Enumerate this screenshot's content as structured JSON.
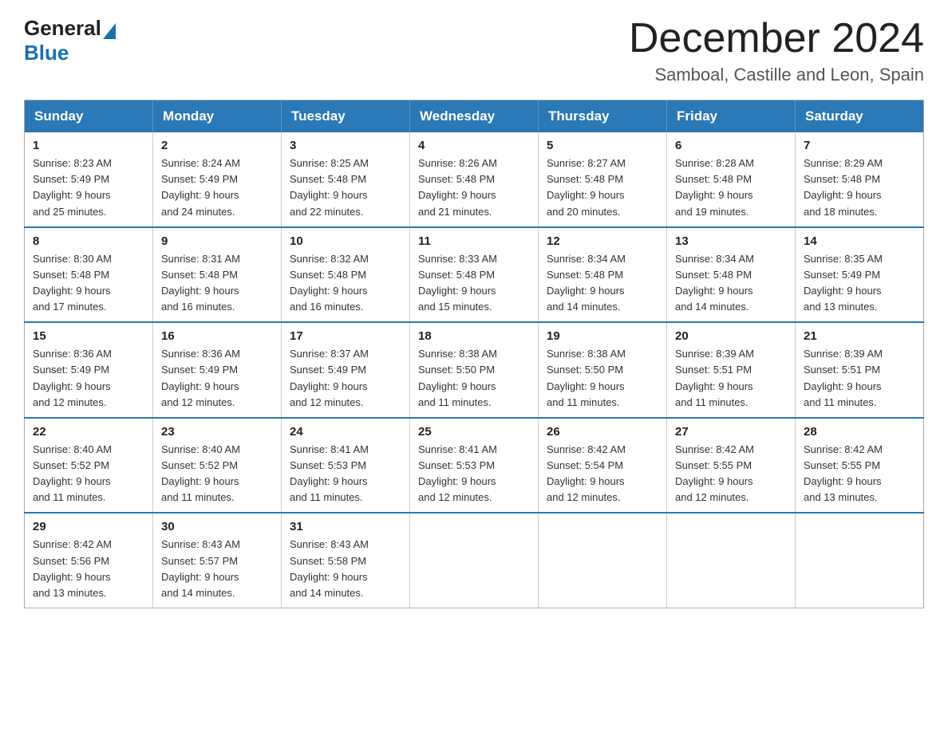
{
  "header": {
    "logo": {
      "text_general": "General",
      "text_blue": "Blue",
      "triangle_aria": "logo-triangle-icon"
    },
    "month_title": "December 2024",
    "location": "Samboal, Castille and Leon, Spain"
  },
  "days_of_week": [
    "Sunday",
    "Monday",
    "Tuesday",
    "Wednesday",
    "Thursday",
    "Friday",
    "Saturday"
  ],
  "weeks": [
    [
      {
        "day": "1",
        "sunrise": "Sunrise: 8:23 AM",
        "sunset": "Sunset: 5:49 PM",
        "daylight": "Daylight: 9 hours",
        "daylight2": "and 25 minutes."
      },
      {
        "day": "2",
        "sunrise": "Sunrise: 8:24 AM",
        "sunset": "Sunset: 5:49 PM",
        "daylight": "Daylight: 9 hours",
        "daylight2": "and 24 minutes."
      },
      {
        "day": "3",
        "sunrise": "Sunrise: 8:25 AM",
        "sunset": "Sunset: 5:48 PM",
        "daylight": "Daylight: 9 hours",
        "daylight2": "and 22 minutes."
      },
      {
        "day": "4",
        "sunrise": "Sunrise: 8:26 AM",
        "sunset": "Sunset: 5:48 PM",
        "daylight": "Daylight: 9 hours",
        "daylight2": "and 21 minutes."
      },
      {
        "day": "5",
        "sunrise": "Sunrise: 8:27 AM",
        "sunset": "Sunset: 5:48 PM",
        "daylight": "Daylight: 9 hours",
        "daylight2": "and 20 minutes."
      },
      {
        "day": "6",
        "sunrise": "Sunrise: 8:28 AM",
        "sunset": "Sunset: 5:48 PM",
        "daylight": "Daylight: 9 hours",
        "daylight2": "and 19 minutes."
      },
      {
        "day": "7",
        "sunrise": "Sunrise: 8:29 AM",
        "sunset": "Sunset: 5:48 PM",
        "daylight": "Daylight: 9 hours",
        "daylight2": "and 18 minutes."
      }
    ],
    [
      {
        "day": "8",
        "sunrise": "Sunrise: 8:30 AM",
        "sunset": "Sunset: 5:48 PM",
        "daylight": "Daylight: 9 hours",
        "daylight2": "and 17 minutes."
      },
      {
        "day": "9",
        "sunrise": "Sunrise: 8:31 AM",
        "sunset": "Sunset: 5:48 PM",
        "daylight": "Daylight: 9 hours",
        "daylight2": "and 16 minutes."
      },
      {
        "day": "10",
        "sunrise": "Sunrise: 8:32 AM",
        "sunset": "Sunset: 5:48 PM",
        "daylight": "Daylight: 9 hours",
        "daylight2": "and 16 minutes."
      },
      {
        "day": "11",
        "sunrise": "Sunrise: 8:33 AM",
        "sunset": "Sunset: 5:48 PM",
        "daylight": "Daylight: 9 hours",
        "daylight2": "and 15 minutes."
      },
      {
        "day": "12",
        "sunrise": "Sunrise: 8:34 AM",
        "sunset": "Sunset: 5:48 PM",
        "daylight": "Daylight: 9 hours",
        "daylight2": "and 14 minutes."
      },
      {
        "day": "13",
        "sunrise": "Sunrise: 8:34 AM",
        "sunset": "Sunset: 5:48 PM",
        "daylight": "Daylight: 9 hours",
        "daylight2": "and 14 minutes."
      },
      {
        "day": "14",
        "sunrise": "Sunrise: 8:35 AM",
        "sunset": "Sunset: 5:49 PM",
        "daylight": "Daylight: 9 hours",
        "daylight2": "and 13 minutes."
      }
    ],
    [
      {
        "day": "15",
        "sunrise": "Sunrise: 8:36 AM",
        "sunset": "Sunset: 5:49 PM",
        "daylight": "Daylight: 9 hours",
        "daylight2": "and 12 minutes."
      },
      {
        "day": "16",
        "sunrise": "Sunrise: 8:36 AM",
        "sunset": "Sunset: 5:49 PM",
        "daylight": "Daylight: 9 hours",
        "daylight2": "and 12 minutes."
      },
      {
        "day": "17",
        "sunrise": "Sunrise: 8:37 AM",
        "sunset": "Sunset: 5:49 PM",
        "daylight": "Daylight: 9 hours",
        "daylight2": "and 12 minutes."
      },
      {
        "day": "18",
        "sunrise": "Sunrise: 8:38 AM",
        "sunset": "Sunset: 5:50 PM",
        "daylight": "Daylight: 9 hours",
        "daylight2": "and 11 minutes."
      },
      {
        "day": "19",
        "sunrise": "Sunrise: 8:38 AM",
        "sunset": "Sunset: 5:50 PM",
        "daylight": "Daylight: 9 hours",
        "daylight2": "and 11 minutes."
      },
      {
        "day": "20",
        "sunrise": "Sunrise: 8:39 AM",
        "sunset": "Sunset: 5:51 PM",
        "daylight": "Daylight: 9 hours",
        "daylight2": "and 11 minutes."
      },
      {
        "day": "21",
        "sunrise": "Sunrise: 8:39 AM",
        "sunset": "Sunset: 5:51 PM",
        "daylight": "Daylight: 9 hours",
        "daylight2": "and 11 minutes."
      }
    ],
    [
      {
        "day": "22",
        "sunrise": "Sunrise: 8:40 AM",
        "sunset": "Sunset: 5:52 PM",
        "daylight": "Daylight: 9 hours",
        "daylight2": "and 11 minutes."
      },
      {
        "day": "23",
        "sunrise": "Sunrise: 8:40 AM",
        "sunset": "Sunset: 5:52 PM",
        "daylight": "Daylight: 9 hours",
        "daylight2": "and 11 minutes."
      },
      {
        "day": "24",
        "sunrise": "Sunrise: 8:41 AM",
        "sunset": "Sunset: 5:53 PM",
        "daylight": "Daylight: 9 hours",
        "daylight2": "and 11 minutes."
      },
      {
        "day": "25",
        "sunrise": "Sunrise: 8:41 AM",
        "sunset": "Sunset: 5:53 PM",
        "daylight": "Daylight: 9 hours",
        "daylight2": "and 12 minutes."
      },
      {
        "day": "26",
        "sunrise": "Sunrise: 8:42 AM",
        "sunset": "Sunset: 5:54 PM",
        "daylight": "Daylight: 9 hours",
        "daylight2": "and 12 minutes."
      },
      {
        "day": "27",
        "sunrise": "Sunrise: 8:42 AM",
        "sunset": "Sunset: 5:55 PM",
        "daylight": "Daylight: 9 hours",
        "daylight2": "and 12 minutes."
      },
      {
        "day": "28",
        "sunrise": "Sunrise: 8:42 AM",
        "sunset": "Sunset: 5:55 PM",
        "daylight": "Daylight: 9 hours",
        "daylight2": "and 13 minutes."
      }
    ],
    [
      {
        "day": "29",
        "sunrise": "Sunrise: 8:42 AM",
        "sunset": "Sunset: 5:56 PM",
        "daylight": "Daylight: 9 hours",
        "daylight2": "and 13 minutes."
      },
      {
        "day": "30",
        "sunrise": "Sunrise: 8:43 AM",
        "sunset": "Sunset: 5:57 PM",
        "daylight": "Daylight: 9 hours",
        "daylight2": "and 14 minutes."
      },
      {
        "day": "31",
        "sunrise": "Sunrise: 8:43 AM",
        "sunset": "Sunset: 5:58 PM",
        "daylight": "Daylight: 9 hours",
        "daylight2": "and 14 minutes."
      },
      null,
      null,
      null,
      null
    ]
  ]
}
